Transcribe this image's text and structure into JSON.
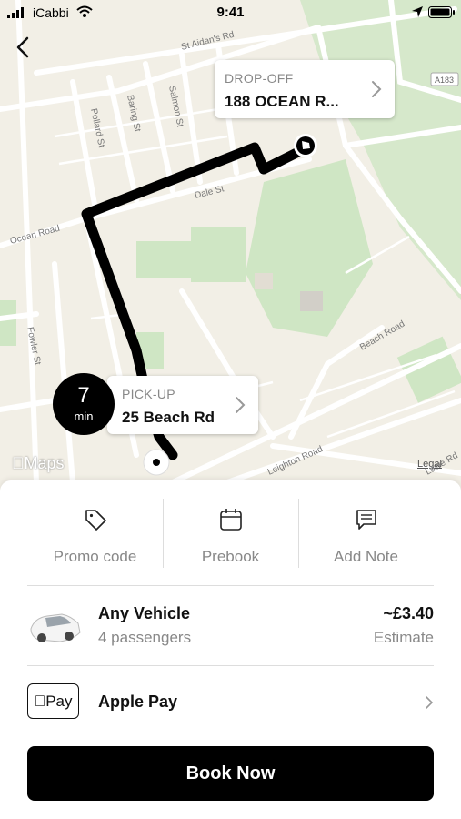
{
  "status_bar": {
    "carrier": "iCabbi",
    "time": "9:41"
  },
  "map": {
    "street_labels": [
      "St Aidan's Rd",
      "Pollard St",
      "Baring St",
      "Salmon St",
      "Dale St",
      "Ocean Road",
      "Fowler St",
      "Beach Road",
      "Leighton Road",
      "A183",
      "Lawe Rd"
    ],
    "route_color": "#000000",
    "park_color": "#cfe6c4"
  },
  "dropoff": {
    "label": "DROP-OFF",
    "address": "188 OCEAN R..."
  },
  "pickup": {
    "label": "PICK-UP",
    "address": "25 Beach Rd"
  },
  "eta": {
    "value": "7",
    "unit": "min"
  },
  "map_attribution": {
    "logo": "Maps",
    "legal": "Legal"
  },
  "actions": [
    {
      "label": "Promo code",
      "icon": "tag-icon"
    },
    {
      "label": "Prebook",
      "icon": "calendar-icon"
    },
    {
      "label": "Add Note",
      "icon": "note-icon"
    }
  ],
  "vehicle": {
    "name": "Any Vehicle",
    "passengers": "4 passengers",
    "price": "~£3.40",
    "price_note": "Estimate"
  },
  "payment": {
    "badge": "Pay",
    "label": "Apple Pay"
  },
  "book_button": "Book Now"
}
